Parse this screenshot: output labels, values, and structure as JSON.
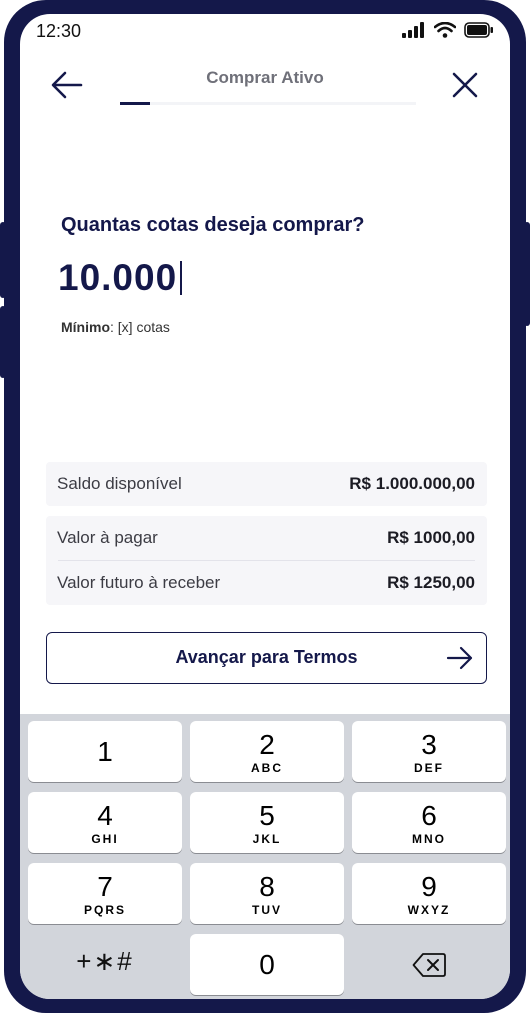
{
  "status_bar": {
    "time": "12:30"
  },
  "header": {
    "title": "Comprar Ativo",
    "progress": 0.1
  },
  "question": "Quantas cotas deseja comprar?",
  "amount": "10.000",
  "minimum": {
    "label": "Mínimo",
    "text": ": [x] cotas"
  },
  "summary": {
    "balance": {
      "label": "Saldo disponível",
      "value": "R$ 1.000.000,00"
    },
    "rows": [
      {
        "label": "Valor à pagar",
        "value": "R$ 1000,00"
      },
      {
        "label": "Valor futuro à receber",
        "value": "R$ 1250,00"
      }
    ]
  },
  "advance_button": {
    "label": "Avançar para Termos"
  },
  "keypad": {
    "keys": [
      {
        "digit": "1",
        "letters": ""
      },
      {
        "digit": "2",
        "letters": "ABC"
      },
      {
        "digit": "3",
        "letters": "DEF"
      },
      {
        "digit": "4",
        "letters": "GHI"
      },
      {
        "digit": "5",
        "letters": "JKL"
      },
      {
        "digit": "6",
        "letters": "MNO"
      },
      {
        "digit": "7",
        "letters": "PQRS"
      },
      {
        "digit": "8",
        "letters": "TUV"
      },
      {
        "digit": "9",
        "letters": "WXYZ"
      }
    ],
    "symbols": "+∗#",
    "zero": "0"
  },
  "colors": {
    "brand": "#14184a",
    "keyboard_bg": "#d2d5db",
    "card_bg": "#f6f6f9"
  }
}
